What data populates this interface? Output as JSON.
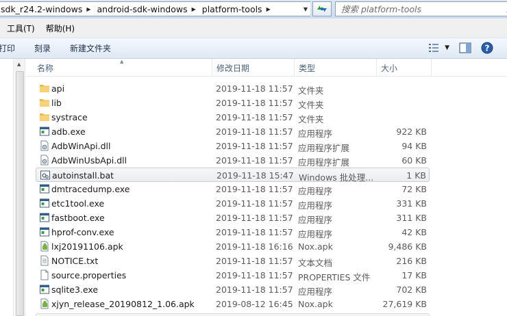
{
  "address": {
    "crumbs": [
      "sdk_r24.2-windows",
      "android-sdk-windows",
      "platform-tools"
    ]
  },
  "search": {
    "placeholder": "搜索 platform-tools"
  },
  "menu": {
    "tools": "工具(T)",
    "help": "帮助(H)"
  },
  "toolbar": {
    "print": "打印",
    "burn": "刻录",
    "new_folder": "新建文件夹"
  },
  "columns": {
    "name": "名称",
    "date": "修改日期",
    "type": "类型",
    "size": "大小"
  },
  "files": [
    {
      "name": "api",
      "date": "2019-11-18 11:57",
      "type": "文件夹",
      "size": "",
      "icon": "folder-icon"
    },
    {
      "name": "lib",
      "date": "2019-11-18 11:57",
      "type": "文件夹",
      "size": "",
      "icon": "folder-icon"
    },
    {
      "name": "systrace",
      "date": "2019-11-18 11:57",
      "type": "文件夹",
      "size": "",
      "icon": "folder-icon"
    },
    {
      "name": "adb.exe",
      "date": "2019-11-18 11:57",
      "type": "应用程序",
      "size": "922 KB",
      "icon": "exe-icon"
    },
    {
      "name": "AdbWinApi.dll",
      "date": "2019-11-18 11:57",
      "type": "应用程序扩展",
      "size": "94 KB",
      "icon": "dll-icon"
    },
    {
      "name": "AdbWinUsbApi.dll",
      "date": "2019-11-18 11:57",
      "type": "应用程序扩展",
      "size": "60 KB",
      "icon": "dll-icon"
    },
    {
      "name": "autoinstall.bat",
      "date": "2019-11-18 15:47",
      "type": "Windows 批处理...",
      "size": "1 KB",
      "icon": "bat-icon",
      "selected": true
    },
    {
      "name": "dmtracedump.exe",
      "date": "2019-11-18 11:57",
      "type": "应用程序",
      "size": "72 KB",
      "icon": "exe-icon"
    },
    {
      "name": "etc1tool.exe",
      "date": "2019-11-18 11:57",
      "type": "应用程序",
      "size": "331 KB",
      "icon": "exe-icon"
    },
    {
      "name": "fastboot.exe",
      "date": "2019-11-18 11:57",
      "type": "应用程序",
      "size": "311 KB",
      "icon": "exe-icon"
    },
    {
      "name": "hprof-conv.exe",
      "date": "2019-11-18 11:57",
      "type": "应用程序",
      "size": "42 KB",
      "icon": "exe-icon"
    },
    {
      "name": "lxj20191106.apk",
      "date": "2019-11-18 16:16",
      "type": "Nox.apk",
      "size": "9,486 KB",
      "icon": "apk-icon"
    },
    {
      "name": "NOTICE.txt",
      "date": "2019-11-18 11:57",
      "type": "文本文档",
      "size": "216 KB",
      "icon": "txt-icon"
    },
    {
      "name": "source.properties",
      "date": "2019-11-18 11:57",
      "type": "PROPERTIES 文件",
      "size": "17 KB",
      "icon": "file-icon"
    },
    {
      "name": "sqlite3.exe",
      "date": "2019-11-18 11:57",
      "type": "应用程序",
      "size": "702 KB",
      "icon": "exe-icon"
    },
    {
      "name": "xjyn_release_20190812_1.06.apk",
      "date": "2019-08-12 16:45",
      "type": "Nox.apk",
      "size": "27,619 KB",
      "icon": "apk-icon"
    }
  ]
}
